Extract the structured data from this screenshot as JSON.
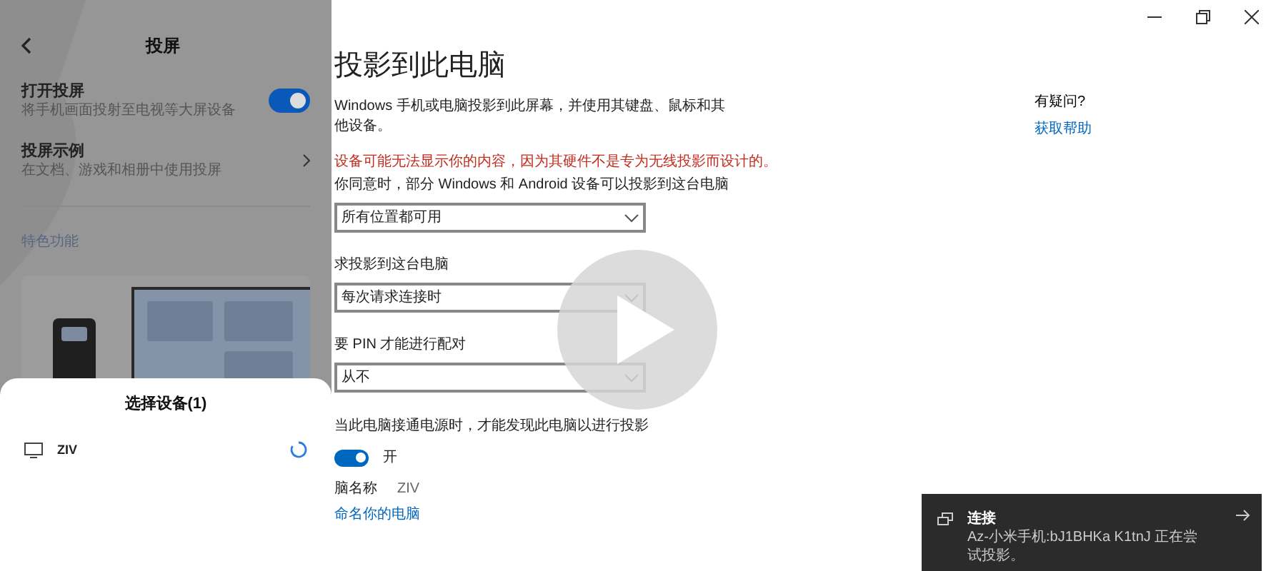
{
  "settings": {
    "title": "投影到此电脑",
    "description": "Windows 手机或电脑投影到此屏幕，并使用其键盘、鼠标和其他设备。",
    "warning": "设备可能无法显示你的内容，因为其硬件不是专为无线投影而设计的。",
    "dropdowns": [
      {
        "label": "你同意时，部分 Windows 和 Android 设备可以投影到这台电脑",
        "value": "所有位置都可用"
      },
      {
        "label": "求投影到这台电脑",
        "value": "每次请求连接时"
      },
      {
        "label": "要 PIN 才能进行配对",
        "value": "从不"
      }
    ],
    "power_label": "当此电脑接通电源时，才能发现此电脑以进行投影",
    "power_toggle": {
      "on": true,
      "label": "开"
    },
    "pc_name": {
      "label": "脑名称",
      "value": "ZIV"
    },
    "rename_link": "命名你的电脑"
  },
  "help": {
    "question": "有疑问?",
    "link": "获取帮助"
  },
  "phone": {
    "title": "投屏",
    "items": [
      {
        "kind": "toggle",
        "title": "打开投屏",
        "subtitle": "将手机画面投射至电视等大屏设备",
        "on": true
      },
      {
        "kind": "link",
        "title": "投屏示例",
        "subtitle": "在文档、游戏和相册中使用投屏"
      }
    ],
    "section": "特色功能",
    "sheet": {
      "title": "选择设备(1)",
      "devices": [
        {
          "name": "ZIV",
          "connecting": true
        }
      ]
    }
  },
  "toast": {
    "title": "连接",
    "message": "Az-小米手机:bJ1BHKa K1tnJ 正在尝试投影。"
  }
}
